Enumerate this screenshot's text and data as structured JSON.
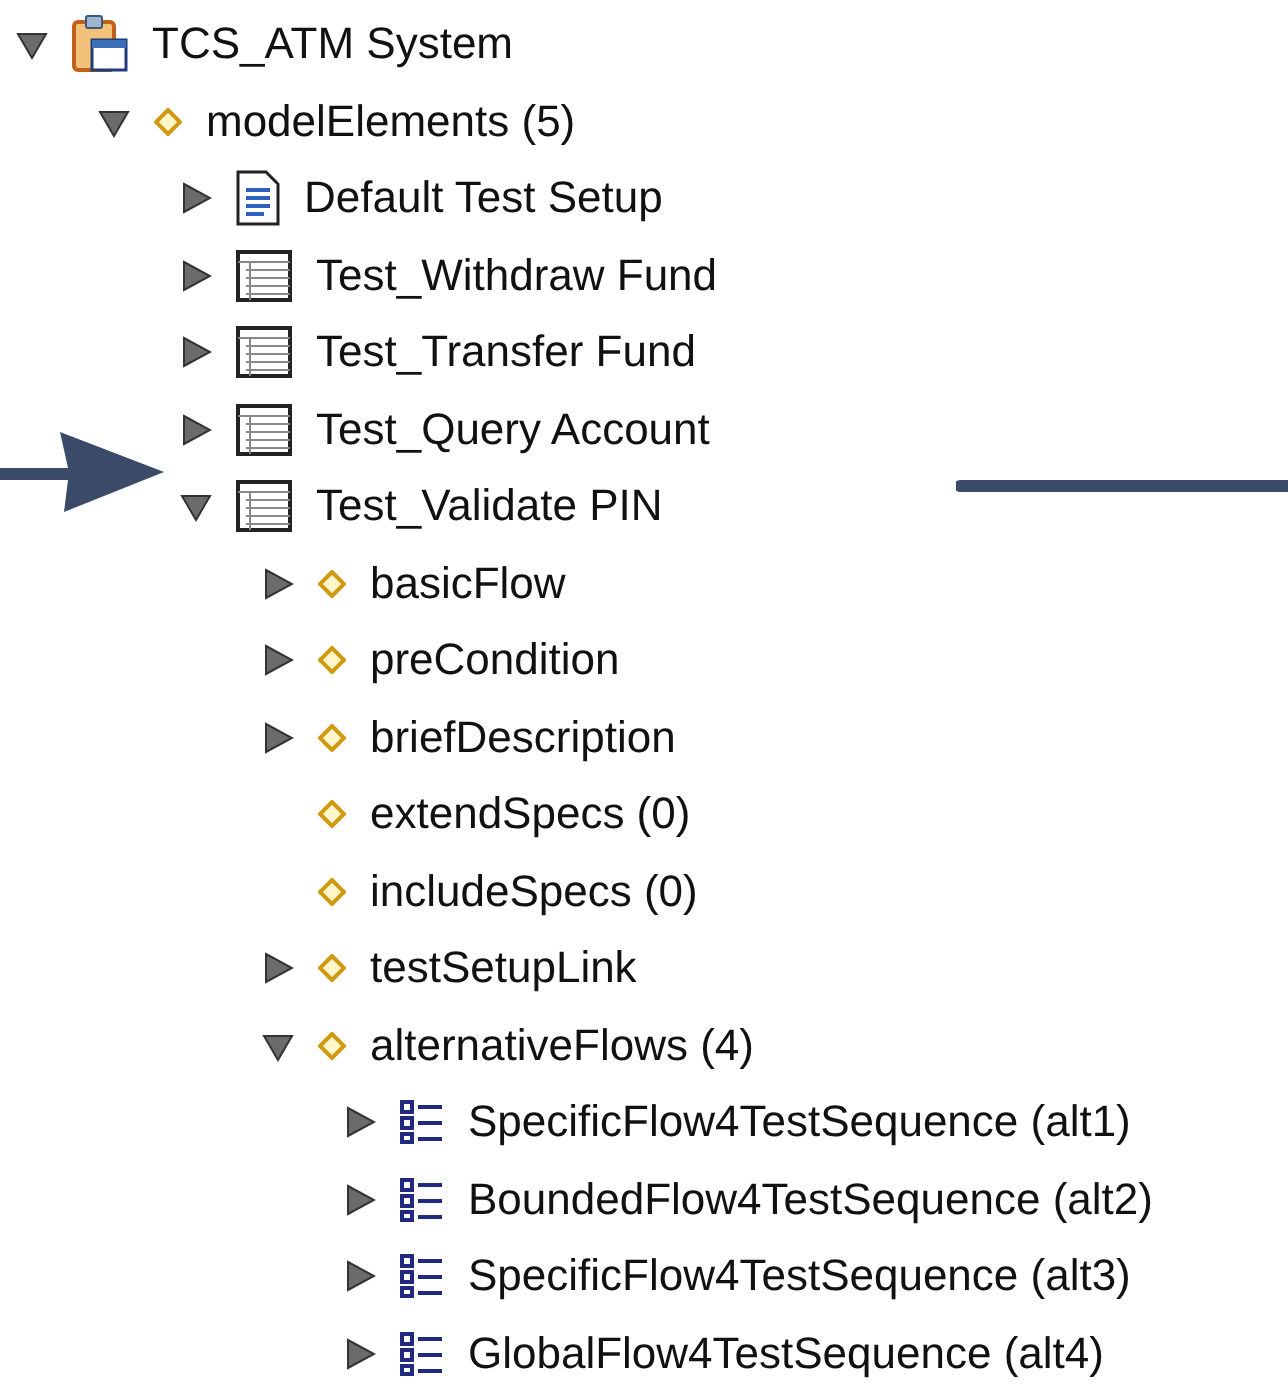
{
  "tree": [
    {
      "label": "TCS_ATM System",
      "kind": "project",
      "expanded": true,
      "children": [
        {
          "label": "modelElements (5)",
          "kind": "feature",
          "expanded": true,
          "children": [
            {
              "label": "Default Test Setup",
              "kind": "document",
              "expanded": false
            },
            {
              "label": "Test_Withdraw Fund",
              "kind": "table",
              "expanded": false
            },
            {
              "label": "Test_Transfer Fund",
              "kind": "table",
              "expanded": false
            },
            {
              "label": "Test_Query Account",
              "kind": "table",
              "expanded": false
            },
            {
              "label": "Test_Validate PIN",
              "kind": "table",
              "expanded": true,
              "children": [
                {
                  "label": "basicFlow",
                  "kind": "feature",
                  "expanded": false
                },
                {
                  "label": "preCondition",
                  "kind": "feature",
                  "expanded": false
                },
                {
                  "label": "briefDescription",
                  "kind": "feature",
                  "expanded": false
                },
                {
                  "label": "extendSpecs (0)",
                  "kind": "feature"
                },
                {
                  "label": "includeSpecs (0)",
                  "kind": "feature"
                },
                {
                  "label": "testSetupLink",
                  "kind": "feature",
                  "expanded": false
                },
                {
                  "label": "alternativeFlows (4)",
                  "kind": "feature",
                  "expanded": true,
                  "children": [
                    {
                      "label": "SpecificFlow4TestSequence (alt1)",
                      "kind": "list",
                      "expanded": false
                    },
                    {
                      "label": "BoundedFlow4TestSequence (alt2)",
                      "kind": "list",
                      "expanded": false
                    },
                    {
                      "label": "SpecificFlow4TestSequence (alt3)",
                      "kind": "list",
                      "expanded": false
                    },
                    {
                      "label": "GlobalFlow4TestSequence (alt4)",
                      "kind": "list",
                      "expanded": false
                    }
                  ]
                }
              ]
            }
          ]
        }
      ]
    }
  ]
}
